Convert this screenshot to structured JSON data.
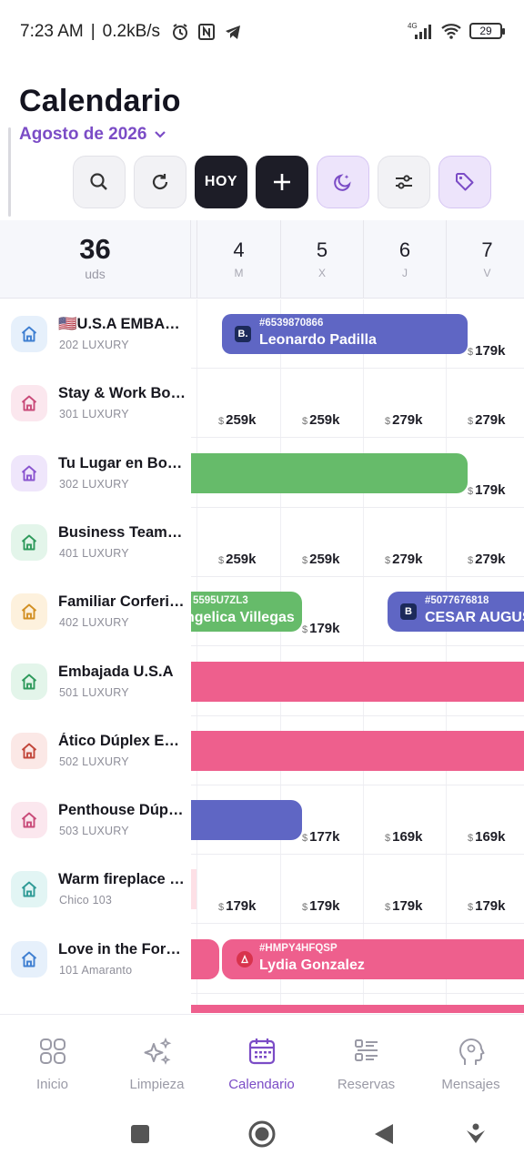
{
  "status": {
    "time": "7:23 AM",
    "speed": "0.2kB/s",
    "battery": "29",
    "network": "4G"
  },
  "header": {
    "title": "Calendario",
    "month": "Agosto de 2026"
  },
  "toolbar": {
    "today_label": "HOY"
  },
  "units_count": {
    "value": "36",
    "label": "uds"
  },
  "days": [
    {
      "num": "4",
      "letter": "M"
    },
    {
      "num": "5",
      "letter": "X"
    },
    {
      "num": "6",
      "letter": "J"
    },
    {
      "num": "7",
      "letter": "V"
    }
  ],
  "currency": "$",
  "rows": [
    {
      "name": "🇺🇸U.S.A EMBAJADA",
      "sub": "202 LUXURY",
      "tint": "#e6f0fb",
      "color": "#3f7fd1",
      "prices": [
        "",
        "",
        "",
        "179k"
      ]
    },
    {
      "name": "Stay & Work Bogotá",
      "sub": "301 LUXURY",
      "tint": "#fbe7ee",
      "color": "#c94b79",
      "prices": [
        "259k",
        "259k",
        "279k",
        "279k"
      ]
    },
    {
      "name": "Tu Lugar en Bogotá",
      "sub": "302 LUXURY",
      "tint": "#efe6fb",
      "color": "#8a55cf",
      "prices": [
        "",
        "",
        "",
        "179k"
      ]
    },
    {
      "name": "Business Team Suite",
      "sub": "401 LUXURY",
      "tint": "#e3f5ea",
      "color": "#2f9a5c",
      "prices": [
        "259k",
        "259k",
        "279k",
        "279k"
      ]
    },
    {
      "name": "Familiar Corferias",
      "sub": "402 LUXURY",
      "tint": "#fdf1dd",
      "color": "#d29024",
      "prices": [
        "",
        "179k",
        "",
        ""
      ]
    },
    {
      "name": "Embajada U.S.A",
      "sub": "501 LUXURY",
      "tint": "#e3f5ea",
      "color": "#2f9a5c",
      "prices": [
        "",
        "",
        "",
        ""
      ]
    },
    {
      "name": "Ático Dúplex Exclusivo",
      "sub": "502 LUXURY",
      "tint": "#fbe8e6",
      "color": "#c2473b",
      "prices": [
        "",
        "",
        "",
        ""
      ]
    },
    {
      "name": "Penthouse Dúplex",
      "sub": "503 LUXURY",
      "tint": "#fbe7ee",
      "color": "#c94b79",
      "prices": [
        "",
        "177k",
        "169k",
        "169k"
      ]
    },
    {
      "name": "Warm fireplace house",
      "sub": "Chico 103",
      "tint": "#e2f5f4",
      "color": "#2f9b96",
      "prices": [
        "179k",
        "179k",
        "179k",
        "179k"
      ]
    },
    {
      "name": "Love in the Forest",
      "sub": "101 Amaranto",
      "tint": "#e6f0fb",
      "color": "#3f7fd1",
      "prices": [
        "",
        "",
        "",
        ""
      ]
    }
  ],
  "reservations": [
    {
      "code": "#6539870866",
      "guest": "Leonardo Padilla",
      "badge": "B.",
      "color": "#5f66c4"
    },
    {
      "code": "5595U7ZL3",
      "guest": "ngelica Villegas",
      "color": "#66bb6a"
    },
    {
      "code": "#5077676818",
      "guest": "CESAR AUGUSTO",
      "badge": "B",
      "color": "#5f66c4"
    },
    {
      "code": "#HMPY4HFQSP",
      "guest": "Lydia Gonzalez",
      "color": "#ee5f8d"
    }
  ],
  "bar_colors": {
    "green": "#66bb6a",
    "pink": "#ee5f8d",
    "blue": "#5f66c4"
  },
  "nav": [
    {
      "label": "Inicio",
      "icon": "grid-icon"
    },
    {
      "label": "Limpieza",
      "icon": "sparkles-icon"
    },
    {
      "label": "Calendario",
      "icon": "calendar-icon",
      "active": true
    },
    {
      "label": "Reservas",
      "icon": "list-icon"
    },
    {
      "label": "Mensajes",
      "icon": "head-icon"
    }
  ],
  "accent": "#7b4cc6"
}
